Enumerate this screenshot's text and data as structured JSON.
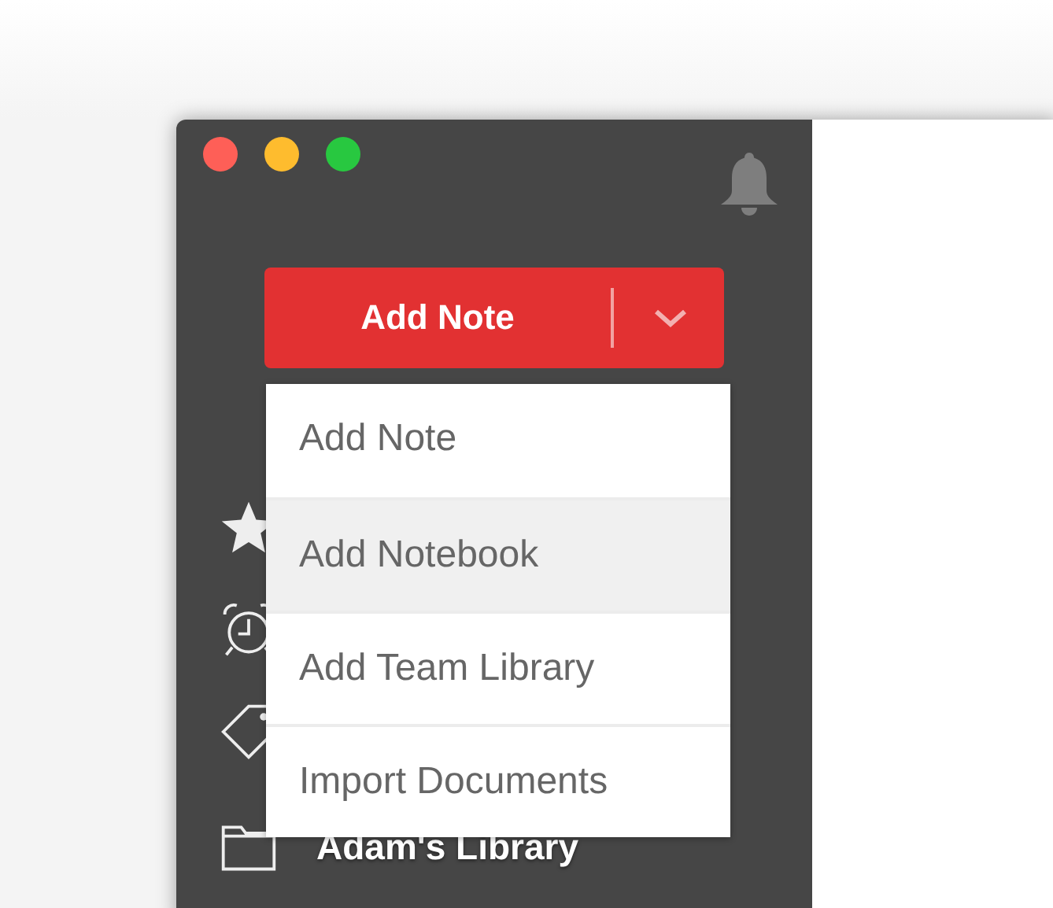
{
  "add_button": {
    "label": "Add Note"
  },
  "add_menu": {
    "items": [
      {
        "label": "Add Note",
        "selected": false
      },
      {
        "label": "Add Notebook",
        "selected": true
      },
      {
        "label": "Add Team Library",
        "selected": false
      },
      {
        "label": "Import Documents",
        "selected": false
      }
    ]
  },
  "sidebar": {
    "library": {
      "label": "Adam's Library"
    }
  }
}
